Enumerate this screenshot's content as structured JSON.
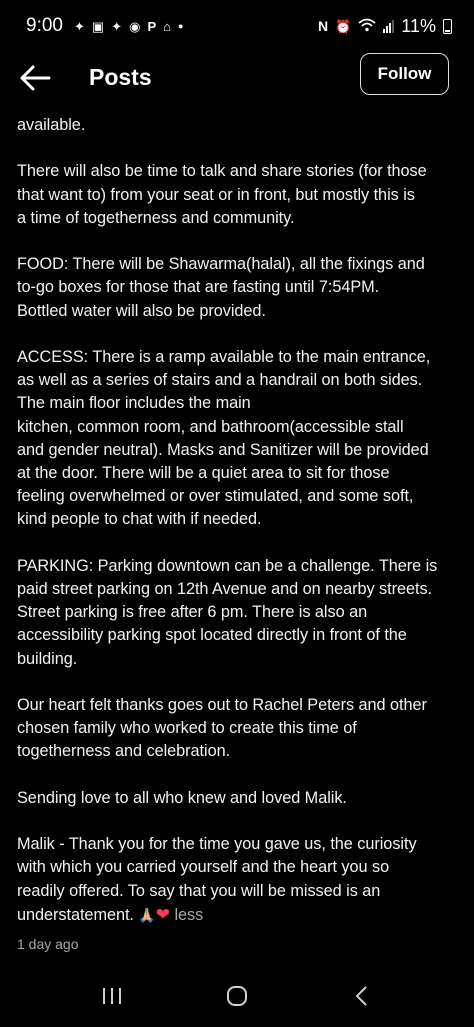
{
  "status_bar": {
    "time": "9:00",
    "battery_percent": "11%",
    "left_icons": [
      "notification-icon-1",
      "screenshot-icon",
      "notification-icon-2",
      "messenger-icon",
      "paypal-icon",
      "home-icon",
      "more-dot-icon"
    ],
    "right_icons": [
      "nfc-icon",
      "alarm-icon",
      "wifi-icon",
      "signal-icon",
      "battery-icon"
    ]
  },
  "header": {
    "title": "Posts",
    "follow_label": "Follow"
  },
  "post": {
    "paragraphs": [
      [
        "available."
      ],
      [
        "There will also be time to talk and share stories (for those",
        "that want to) from your seat or in front, but mostly this is",
        "a time of togetherness and community."
      ],
      [
        "FOOD: There will be Shawarma(halal), all the fixings and",
        "to-go boxes for those that are fasting until 7:54PM.",
        "Bottled water will also be provided."
      ],
      [
        "ACCESS: There is a ramp available to the main entrance,",
        "as well as a series of stairs and a handrail on both sides.",
        "The main floor includes the main",
        "kitchen, common room, and bathroom(accessible stall",
        "and gender neutral). Masks and Sanitizer will be provided",
        "at the door. There will be a quiet area to sit for those",
        "feeling overwhelmed or over stimulated, and some soft,",
        "kind people to chat with if needed."
      ],
      [
        "PARKING: Parking downtown can be a challenge. There is",
        "paid street parking on 12th Avenue and on nearby streets.",
        "Street parking is free after 6 pm. There is also an",
        "accessibility parking spot located directly in front of the",
        "building."
      ],
      [
        "Our heart felt thanks goes out to Rachel Peters and other",
        "chosen family who worked to create this time of",
        "togetherness and celebration."
      ],
      [
        "Sending love to all who knew and loved Malik."
      ],
      [
        "Malik - Thank you for the time you gave us, the curiosity",
        "with which you carried yourself and the heart you so",
        "readily offered. To say that you will be missed is an"
      ]
    ],
    "last_line_text": "understatement.",
    "emoji_hands": "🙏🏼",
    "emoji_heart": "❤",
    "less_label": "less",
    "timestamp": "1 day ago"
  },
  "nav_bar": {
    "buttons": [
      "recent-apps-icon",
      "home-icon",
      "back-icon"
    ]
  },
  "colors": {
    "background": "#000000",
    "text": "#f2f2f2",
    "muted": "#a8a8a8",
    "heart": "#ff3b5c"
  }
}
